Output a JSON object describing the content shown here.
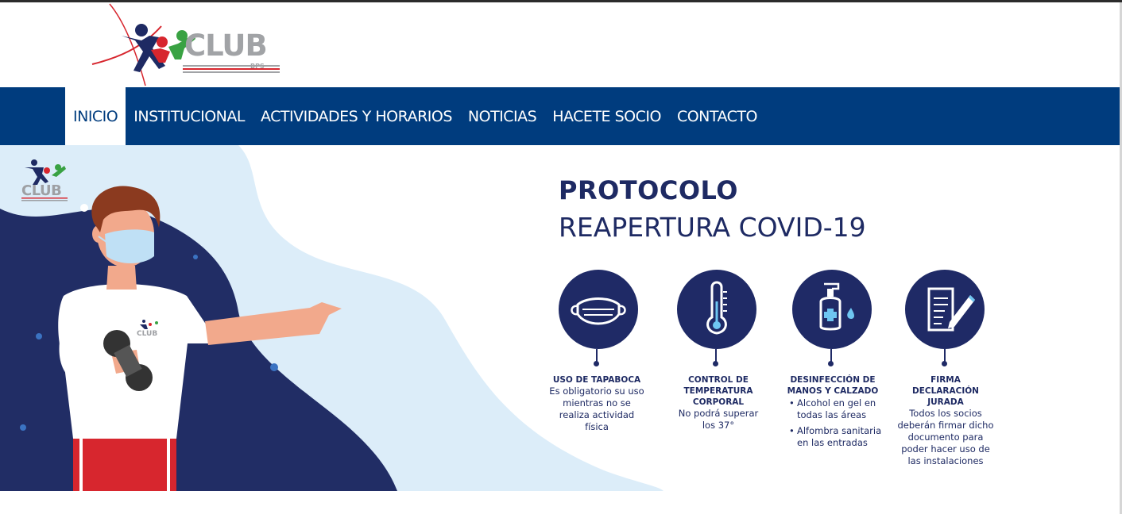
{
  "header": {
    "logo": {
      "text": "CLUB",
      "subtext": "BPS"
    }
  },
  "nav": {
    "items": [
      {
        "label": "INICIO",
        "active": true
      },
      {
        "label": "INSTITUCIONAL",
        "active": false
      },
      {
        "label": "ACTIVIDADES Y HORARIOS",
        "active": false
      },
      {
        "label": "NOTICIAS",
        "active": false
      },
      {
        "label": "HACETE SOCIO",
        "active": false
      },
      {
        "label": "CONTACTO",
        "active": false
      }
    ]
  },
  "banner": {
    "title": "PROTOCOLO",
    "subtitle": "REAPERTURA COVID-19",
    "mini_logo_text": "CLUB",
    "shirt_logo_text": "CLUB",
    "steps": [
      {
        "icon": "face-mask-icon",
        "title": "USO DE TAPABOCA",
        "body": "Es obligatorio su uso mientras no se realiza actividad física"
      },
      {
        "icon": "thermometer-icon",
        "title": "CONTROL DE TEMPERATURA CORPORAL",
        "body": "No podrá superar los 37°"
      },
      {
        "icon": "sanitizer-icon",
        "title": "DESINFECCIÓN DE MANOS Y CALZADO",
        "bullets": [
          "Alcohol en gel en todas las áreas",
          "Alfombra sanitaria en las entradas"
        ]
      },
      {
        "icon": "signed-document-icon",
        "title": "FIRMA DECLARACIÓN JURADA",
        "body": "Todos los socios deberán firmar dicho documento para poder hacer uso de las instalaciones"
      }
    ]
  },
  "colors": {
    "nav_bg": "#003c7e",
    "navy": "#1e2a63",
    "light_blue": "#dcedf9",
    "logo_gray": "#a1a3a6",
    "logo_red": "#d7262e"
  }
}
